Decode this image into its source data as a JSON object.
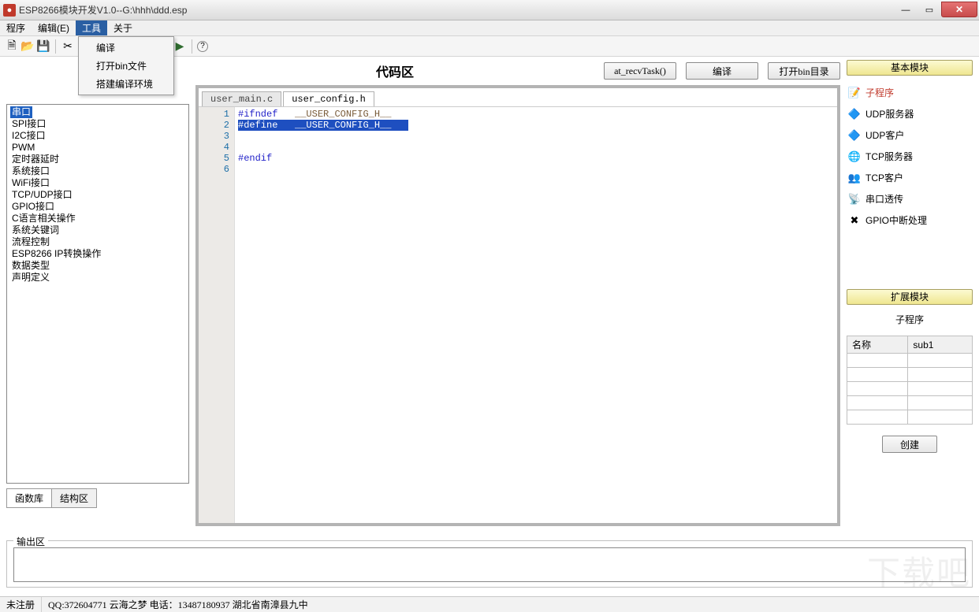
{
  "window": {
    "title": "ESP8266模块开发V1.0--G:\\hhh\\ddd.esp"
  },
  "menubar": {
    "items": [
      "程序",
      "编辑(E)",
      "工具",
      "关于"
    ],
    "active_index": 2,
    "dropdown": [
      "编译",
      "打开bin文件",
      "搭建编译环境"
    ]
  },
  "toolbar_icons": {
    "new": "🗎",
    "open": "📂",
    "save": "💾",
    "cut": "✂",
    "copy": "📋",
    "paste": "📄",
    "undo": "↶",
    "redo": "↷",
    "find": "🔎",
    "run": "▶",
    "help": "?"
  },
  "left": {
    "items": [
      "串口",
      "SPI接口",
      "I2C接口",
      "PWM",
      "定时器延时",
      "系统接口",
      "WiFi接口",
      "TCP/UDP接口",
      "GPIO接口",
      "C语言相关操作",
      "系统关键词",
      "流程控制",
      "ESP8266 IP转换操作",
      "数据类型",
      "声明定义"
    ],
    "selected_index": 0,
    "tabs": [
      "函数库",
      "结构区"
    ],
    "active_tab": 0
  },
  "center": {
    "title": "代码区",
    "buttons": {
      "recv": "at_recvTask()",
      "compile": "编译",
      "openbin": "打开bin目录"
    },
    "tabs": [
      "user_main.c",
      "user_config.h"
    ],
    "active_tab": 1,
    "gutter": [
      "1",
      "2",
      "3",
      "4",
      "5",
      "6"
    ],
    "code": {
      "l1_kw": "#ifndef",
      "l1_mac": "__USER_CONFIG_H__",
      "l2_kw": "#define",
      "l2_mac": "__USER_CONFIG_H__",
      "l5_kw": "#endif"
    }
  },
  "right": {
    "group1": "基本模块",
    "modules": [
      {
        "icon": "📝",
        "label": "子程序",
        "highlight": true
      },
      {
        "icon": "🔷",
        "label": "UDP服务器"
      },
      {
        "icon": "🔷",
        "label": "UDP客户"
      },
      {
        "icon": "🌐",
        "label": "TCP服务器"
      },
      {
        "icon": "👥",
        "label": "TCP客户"
      },
      {
        "icon": "📡",
        "label": "串口透传"
      },
      {
        "icon": "✖",
        "label": "GPIO中断处理"
      }
    ],
    "group2": "扩展模块",
    "sub_title": "子程序",
    "table": {
      "headers": [
        "名称",
        "sub1"
      ],
      "rows": 5
    },
    "create": "创建"
  },
  "output": {
    "legend": "输出区"
  },
  "statusbar": {
    "seg1": "未注册",
    "seg2": "QQ:372604771 云海之梦  电话：13487180937  湖北省南漳县九中"
  },
  "watermark": "下载吧"
}
